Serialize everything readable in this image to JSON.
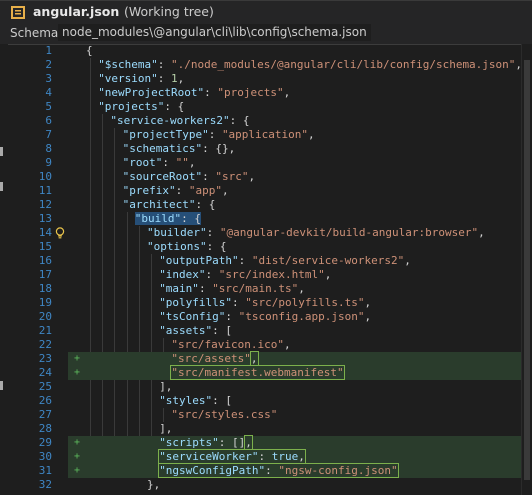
{
  "title": {
    "filename": "angular.json",
    "status": "(Working tree)"
  },
  "schema": {
    "label": "Schema:",
    "path": "node_modules\\@angular\\cli\\lib\\config\\schema.json"
  },
  "icons": {
    "file": "json-file-icon",
    "bulb": "lightbulb-icon"
  },
  "colors": {
    "key": "#9cdcfe",
    "string": "#ce9178",
    "number": "#b5cea8",
    "line_number": "#3f86c4",
    "added_bg": "#2a3c2c",
    "selection": "#264f78"
  },
  "lines": [
    {
      "n": "1",
      "ind": 0,
      "t": [
        [
          "p",
          "{"
        ]
      ]
    },
    {
      "n": "2",
      "ind": 1,
      "t": [
        [
          "k",
          "\"$schema\""
        ],
        [
          "p",
          ": "
        ],
        [
          "s",
          "\"./node_modules/@angular/cli/lib/config/schema.json\""
        ],
        [
          "p",
          ","
        ]
      ]
    },
    {
      "n": "3",
      "ind": 1,
      "t": [
        [
          "k",
          "\"version\""
        ],
        [
          "p",
          ": "
        ],
        [
          "n",
          "1"
        ],
        [
          "p",
          ","
        ]
      ]
    },
    {
      "n": "4",
      "ind": 1,
      "t": [
        [
          "k",
          "\"newProjectRoot\""
        ],
        [
          "p",
          ": "
        ],
        [
          "s",
          "\"projects\""
        ],
        [
          "p",
          ","
        ]
      ]
    },
    {
      "n": "5",
      "ind": 1,
      "t": [
        [
          "k",
          "\"projects\""
        ],
        [
          "p",
          ": {"
        ]
      ]
    },
    {
      "n": "6",
      "ind": 2,
      "t": [
        [
          "k",
          "\"service-workers2\""
        ],
        [
          "p",
          ": {"
        ]
      ]
    },
    {
      "n": "7",
      "ind": 3,
      "t": [
        [
          "k",
          "\"projectType\""
        ],
        [
          "p",
          ": "
        ],
        [
          "s",
          "\"application\""
        ],
        [
          "p",
          ","
        ]
      ]
    },
    {
      "n": "8",
      "ind": 3,
      "t": [
        [
          "k",
          "\"schematics\""
        ],
        [
          "p",
          ": {},"
        ]
      ]
    },
    {
      "n": "9",
      "ind": 3,
      "t": [
        [
          "k",
          "\"root\""
        ],
        [
          "p",
          ": "
        ],
        [
          "s",
          "\"\""
        ],
        [
          "p",
          ","
        ]
      ]
    },
    {
      "n": "10",
      "ind": 3,
      "t": [
        [
          "k",
          "\"sourceRoot\""
        ],
        [
          "p",
          ": "
        ],
        [
          "s",
          "\"src\""
        ],
        [
          "p",
          ","
        ]
      ]
    },
    {
      "n": "11",
      "ind": 3,
      "t": [
        [
          "k",
          "\"prefix\""
        ],
        [
          "p",
          ": "
        ],
        [
          "s",
          "\"app\""
        ],
        [
          "p",
          ","
        ]
      ]
    },
    {
      "n": "12",
      "ind": 3,
      "t": [
        [
          "k",
          "\"architect\""
        ],
        [
          "p",
          ": {"
        ]
      ]
    },
    {
      "n": "13",
      "ind": 4,
      "sel": true,
      "t": [
        [
          "k",
          "\"build\""
        ],
        [
          "p",
          ": {"
        ]
      ]
    },
    {
      "n": "14",
      "ind": 5,
      "bulb": true,
      "t": [
        [
          "k",
          "\"builder\""
        ],
        [
          "p",
          ": "
        ],
        [
          "s",
          "\"@angular-devkit/build-angular:browser\""
        ],
        [
          "p",
          ","
        ]
      ]
    },
    {
      "n": "15",
      "ind": 5,
      "t": [
        [
          "k",
          "\"options\""
        ],
        [
          "p",
          ": {"
        ]
      ]
    },
    {
      "n": "16",
      "ind": 6,
      "t": [
        [
          "k",
          "\"outputPath\""
        ],
        [
          "p",
          ": "
        ],
        [
          "s",
          "\"dist/service-workers2\""
        ],
        [
          "p",
          ","
        ]
      ]
    },
    {
      "n": "17",
      "ind": 6,
      "t": [
        [
          "k",
          "\"index\""
        ],
        [
          "p",
          ": "
        ],
        [
          "s",
          "\"src/index.html\""
        ],
        [
          "p",
          ","
        ]
      ]
    },
    {
      "n": "18",
      "ind": 6,
      "t": [
        [
          "k",
          "\"main\""
        ],
        [
          "p",
          ": "
        ],
        [
          "s",
          "\"src/main.ts\""
        ],
        [
          "p",
          ","
        ]
      ]
    },
    {
      "n": "19",
      "ind": 6,
      "t": [
        [
          "k",
          "\"polyfills\""
        ],
        [
          "p",
          ": "
        ],
        [
          "s",
          "\"src/polyfills.ts\""
        ],
        [
          "p",
          ","
        ]
      ]
    },
    {
      "n": "20",
      "ind": 6,
      "t": [
        [
          "k",
          "\"tsConfig\""
        ],
        [
          "p",
          ": "
        ],
        [
          "s",
          "\"tsconfig.app.json\""
        ],
        [
          "p",
          ","
        ]
      ]
    },
    {
      "n": "21",
      "ind": 6,
      "t": [
        [
          "k",
          "\"assets\""
        ],
        [
          "p",
          ": ["
        ]
      ]
    },
    {
      "n": "22",
      "ind": 7,
      "t": [
        [
          "s",
          "\"src/favicon.ico\""
        ],
        [
          "p",
          ","
        ]
      ]
    },
    {
      "n": "23",
      "ind": 7,
      "added": true,
      "t": [
        [
          "s",
          "\"src/assets\""
        ],
        [
          "pbox",
          ","
        ]
      ]
    },
    {
      "n": "24",
      "ind": 7,
      "added": true,
      "box": true,
      "t": [
        [
          "s",
          "\"src/manifest.webmanifest\""
        ]
      ]
    },
    {
      "n": "25",
      "ind": 6,
      "t": [
        [
          "p",
          "],"
        ]
      ]
    },
    {
      "n": "26",
      "ind": 6,
      "t": [
        [
          "k",
          "\"styles\""
        ],
        [
          "p",
          ": ["
        ]
      ]
    },
    {
      "n": "27",
      "ind": 7,
      "t": [
        [
          "s",
          "\"src/styles.css\""
        ]
      ]
    },
    {
      "n": "28",
      "ind": 6,
      "t": [
        [
          "p",
          "],"
        ]
      ]
    },
    {
      "n": "29",
      "ind": 6,
      "added": true,
      "t": [
        [
          "k",
          "\"scripts\""
        ],
        [
          "p",
          ": []"
        ],
        [
          "pbox",
          ","
        ]
      ]
    },
    {
      "n": "30",
      "ind": 6,
      "added": true,
      "box": true,
      "t": [
        [
          "k",
          "\"serviceWorker\""
        ],
        [
          "p",
          ": "
        ],
        [
          "kw",
          "true"
        ],
        [
          "p",
          ","
        ]
      ]
    },
    {
      "n": "31",
      "ind": 6,
      "added": true,
      "box": true,
      "t": [
        [
          "k",
          "\"ngswConfigPath\""
        ],
        [
          "p",
          ": "
        ],
        [
          "s",
          "\"ngsw-config.json\""
        ]
      ]
    },
    {
      "n": "32",
      "ind": 5,
      "t": [
        [
          "p",
          "},"
        ]
      ]
    }
  ]
}
